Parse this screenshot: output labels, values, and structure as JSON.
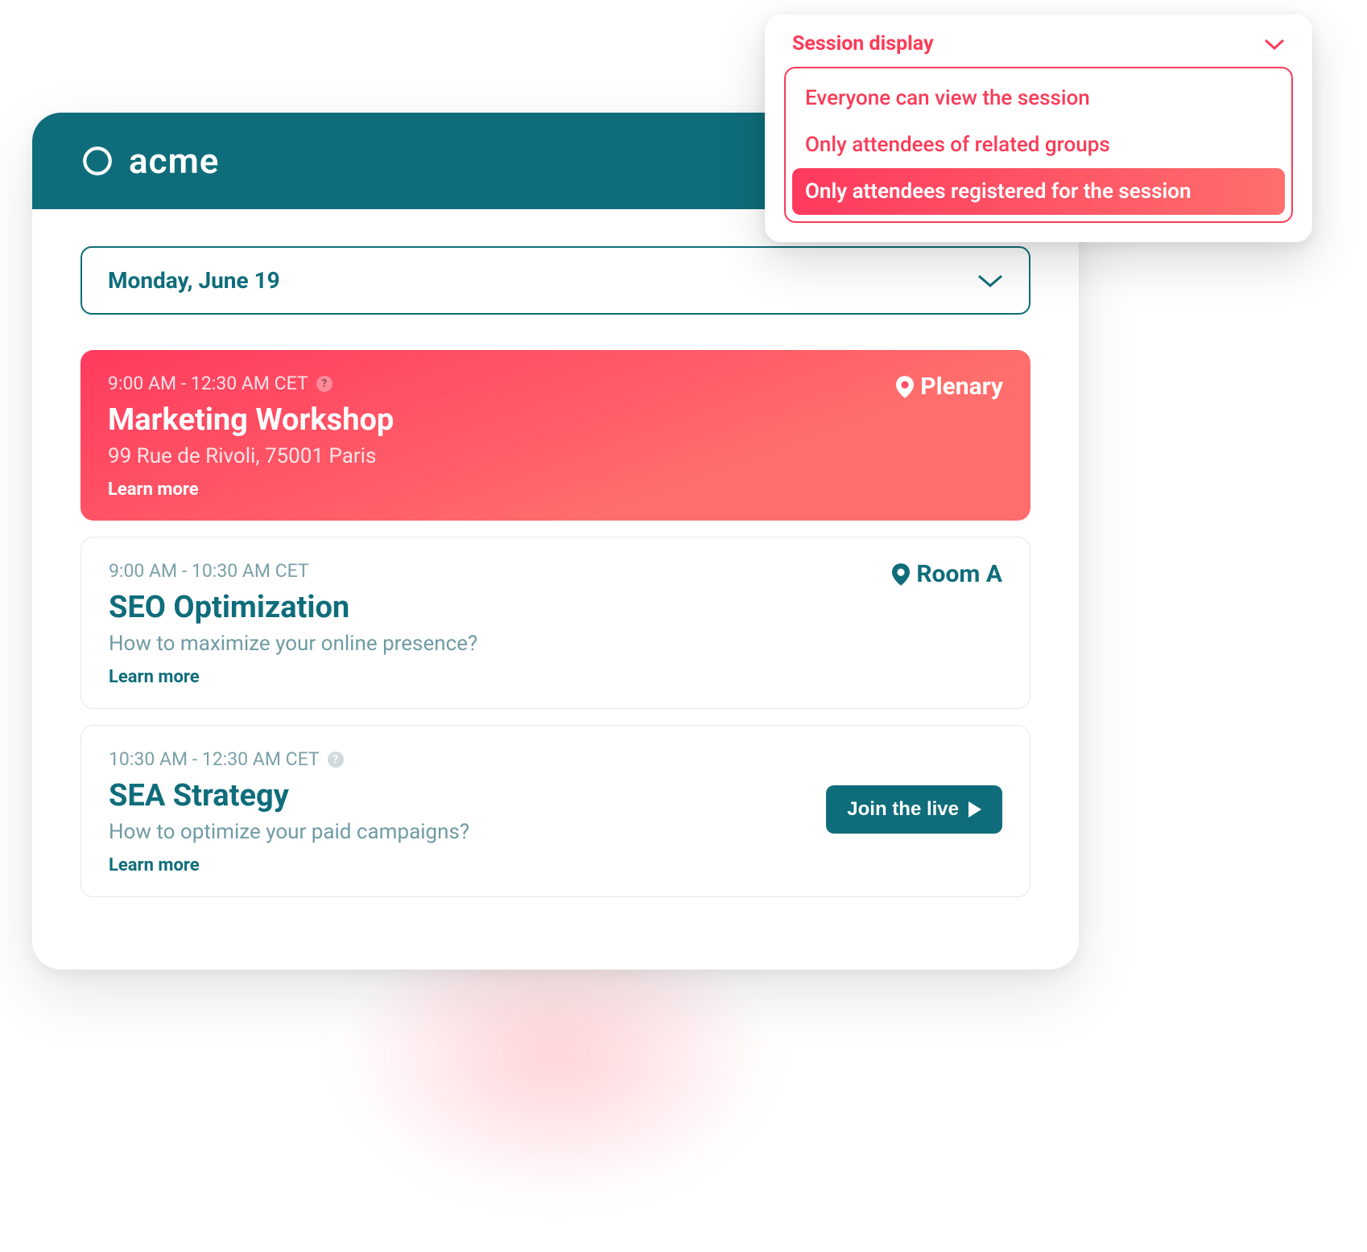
{
  "brand": {
    "name": "acme"
  },
  "date_selector": {
    "label": "Monday, June 19"
  },
  "sessions": [
    {
      "time": "9:00 AM - 12:30 AM CET",
      "has_help": true,
      "title": "Marketing Workshop",
      "subtitle": "99 Rue de Rivoli, 75001  Paris",
      "learn_more": "Learn more",
      "location": "Plenary",
      "featured": true
    },
    {
      "time": "9:00 AM - 10:30 AM CET",
      "has_help": false,
      "title": "SEO Optimization",
      "subtitle": "How to maximize your online presence?",
      "learn_more": "Learn more",
      "location": "Room A",
      "featured": false
    },
    {
      "time": "10:30 AM - 12:30 AM CET",
      "has_help": true,
      "title": "SEA Strategy",
      "subtitle": "How to optimize your paid campaigns?",
      "learn_more": "Learn more",
      "join_label": "Join the live",
      "featured": false
    }
  ],
  "popup": {
    "title": "Session display",
    "options": [
      "Everyone can view the session",
      "Only attendees of related groups",
      "Only attendees registered for the session"
    ],
    "selected_index": 2
  },
  "colors": {
    "teal": "#0f6d7b",
    "red": "#fb3b57",
    "red_grad_a": "#ff3a5e",
    "red_grad_b": "#ff6e6c"
  }
}
